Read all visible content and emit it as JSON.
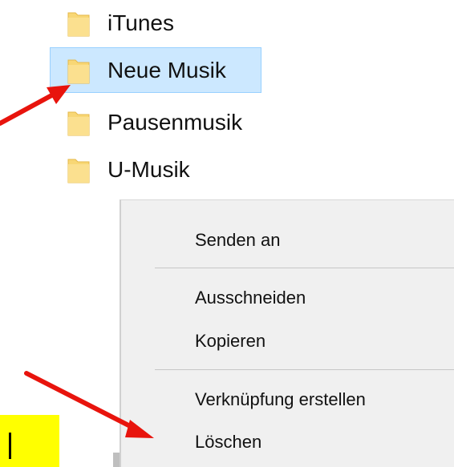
{
  "explorer": {
    "folders": [
      {
        "label": "iTunes",
        "selected": false,
        "icon": "folder-icon"
      },
      {
        "label": "Neue Musik",
        "selected": true,
        "icon": "folder-icon"
      },
      {
        "label": "Pausenmusik",
        "selected": false,
        "icon": "folder-icon"
      },
      {
        "label": "U-Musik",
        "selected": false,
        "icon": "folder-icon"
      }
    ]
  },
  "context_menu": {
    "items": [
      {
        "label": "Senden an"
      },
      {
        "label": "Ausschneiden"
      },
      {
        "label": "Kopieren"
      },
      {
        "label": "Verknüpfung erstellen"
      },
      {
        "label": "Löschen"
      }
    ]
  },
  "colors": {
    "arrow": "#e8140d",
    "selection": "#cce8ff",
    "selection_border": "#99d1ff",
    "folder": "#f8d775",
    "highlight": "#ffff00",
    "menu_background": "#f0f0f0"
  }
}
